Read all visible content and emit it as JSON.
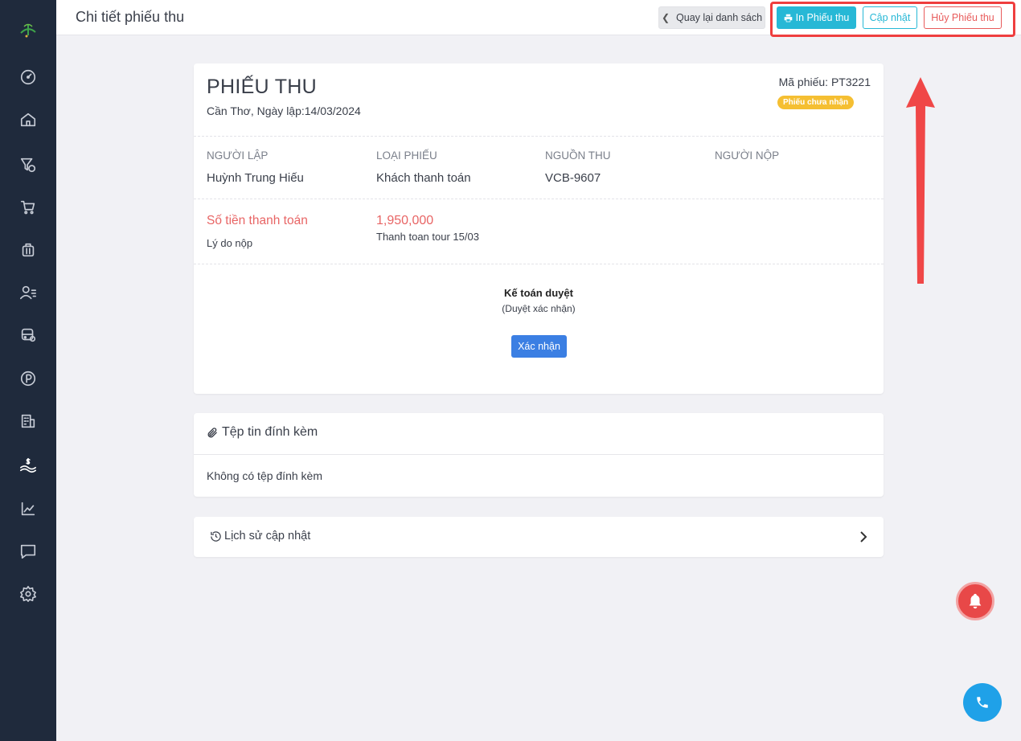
{
  "header": {
    "title": "Chi tiết phiếu thu",
    "back_label": "Quay lại danh sách",
    "print_label": "In Phiếu thu",
    "update_label": "Cập nhật",
    "cancel_label": "Hủy Phiếu thu"
  },
  "sidebar": {
    "items": [
      {
        "icon": "dashboard-icon"
      },
      {
        "icon": "home-icon"
      },
      {
        "icon": "filter-money-icon"
      },
      {
        "icon": "cart-icon"
      },
      {
        "icon": "suitcase-icon"
      },
      {
        "icon": "user-list-icon"
      },
      {
        "icon": "bus-icon"
      },
      {
        "icon": "parking-icon"
      },
      {
        "icon": "building-icon"
      },
      {
        "icon": "money-hand-icon",
        "active": true
      },
      {
        "icon": "chart-icon"
      },
      {
        "icon": "chat-icon"
      },
      {
        "icon": "settings-icon"
      }
    ]
  },
  "receipt": {
    "title": "PHIẾU THU",
    "location_date": "Cần Thơ, Ngày lập:14/03/2024",
    "code": "Mã phiếu: PT3221",
    "status": "Phiếu chưa nhận",
    "fields": [
      {
        "label": "Người lập",
        "value": "Huỳnh Trung Hiếu"
      },
      {
        "label": "Loại phiếu",
        "value": "Khách thanh toán"
      },
      {
        "label": "Nguồn thu",
        "value": "VCB-9607"
      },
      {
        "label": "Người nộp",
        "value": ""
      }
    ],
    "amount_label": "Số tiền thanh toán",
    "amount_value": "1,950,000",
    "reason_label": "Lý do nộp",
    "reason_value": "Thanh toan tour 15/03",
    "approval_title": "Kế toán duyệt",
    "approval_sub": "(Duyệt xác nhận)",
    "confirm_label": "Xác nhận"
  },
  "attachments": {
    "title": "Tệp tin đính kèm",
    "empty_text": "Không có tệp đính kèm"
  },
  "history": {
    "title": "Lịch sử cập nhật"
  },
  "colors": {
    "sidebar_bg": "#1f2a3c",
    "primary": "#27b8d6",
    "danger": "#e85b5b",
    "warning": "#f5bf32",
    "confirm": "#3b7fe3",
    "annotation": "#ef3e3e"
  }
}
